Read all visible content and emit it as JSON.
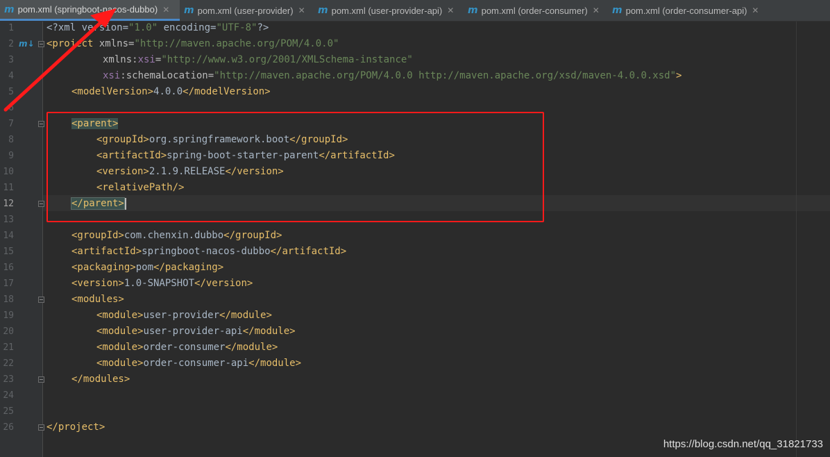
{
  "tabs": [
    {
      "label": "pom.xml (springboot-nacos-dubbo)",
      "icon": "maven-m-icon",
      "active": true
    },
    {
      "label": "pom.xml (user-provider)",
      "icon": "maven-m-icon",
      "active": false
    },
    {
      "label": "pom.xml (user-provider-api)",
      "icon": "maven-m-icon",
      "active": false
    },
    {
      "label": "pom.xml (order-consumer)",
      "icon": "maven-m-icon",
      "active": false
    },
    {
      "label": "pom.xml (order-consumer-api)",
      "icon": "maven-m-icon",
      "active": false
    }
  ],
  "gutter": {
    "maven_icon": "m↓",
    "current_line": 12
  },
  "line_numbers": [
    "1",
    "2",
    "3",
    "4",
    "5",
    "6",
    "7",
    "8",
    "9",
    "10",
    "11",
    "12",
    "13",
    "14",
    "15",
    "16",
    "17",
    "18",
    "19",
    "20",
    "21",
    "22",
    "23",
    "24",
    "25",
    "26"
  ],
  "code": {
    "l1": {
      "p1": "<?xml version=",
      "p2": "\"1.0\"",
      "p3": " encoding=",
      "p4": "\"UTF-8\"",
      "p5": "?>"
    },
    "l2": {
      "p1": "<project ",
      "p2": "xmlns=",
      "p3": "\"http://maven.apache.org/POM/4.0.0\""
    },
    "l3": {
      "p1": "xmlns:",
      "p2": "xsi",
      "p3": "=",
      "p4": "\"http://www.w3.org/2001/XMLSchema-instance\""
    },
    "l4": {
      "p1": "xsi",
      "p2": ":schemaLocation=",
      "p3": "\"http://maven.apache.org/POM/4.0.0 http://maven.apache.org/xsd/maven-4.0.0.xsd\"",
      "p4": ">"
    },
    "l5": {
      "open": "<modelVersion>",
      "text": "4.0.0",
      "close": "</modelVersion>"
    },
    "l7": {
      "open": "<parent>"
    },
    "l8": {
      "open": "<groupId>",
      "text": "org.springframework.boot",
      "close": "</groupId>"
    },
    "l9": {
      "open": "<artifactId>",
      "text": "spring-boot-starter-parent",
      "close": "</artifactId>"
    },
    "l10": {
      "open": "<version>",
      "text": "2.1.9.RELEASE",
      "close": "</version>"
    },
    "l11": {
      "open": "<relativePath/>"
    },
    "l12": {
      "close": "</parent>"
    },
    "l14": {
      "open": "<groupId>",
      "text": "com.chenxin.dubbo",
      "close": "</groupId>"
    },
    "l15": {
      "open": "<artifactId>",
      "text": "springboot-nacos-dubbo",
      "close": "</artifactId>"
    },
    "l16": {
      "open": "<packaging>",
      "text": "pom",
      "close": "</packaging>"
    },
    "l17": {
      "open": "<version>",
      "text": "1.0-SNAPSHOT",
      "close": "</version>"
    },
    "l18": {
      "open": "<modules>"
    },
    "l19": {
      "open": "<module>",
      "text": "user-provider",
      "close": "</module>"
    },
    "l20": {
      "open": "<module>",
      "text": "user-provider-api",
      "close": "</module>"
    },
    "l21": {
      "open": "<module>",
      "text": "order-consumer",
      "close": "</module>"
    },
    "l22": {
      "open": "<module>",
      "text": "order-consumer-api",
      "close": "</module>"
    },
    "l23": {
      "close": "</modules>"
    },
    "l26": {
      "close": "</project>"
    }
  },
  "watermark": "https://blog.csdn.net/qq_31821733",
  "colors": {
    "annotation": "#ff1a1a",
    "tag": "#e8bf6a",
    "string": "#6a8759",
    "background": "#2b2b2b"
  }
}
